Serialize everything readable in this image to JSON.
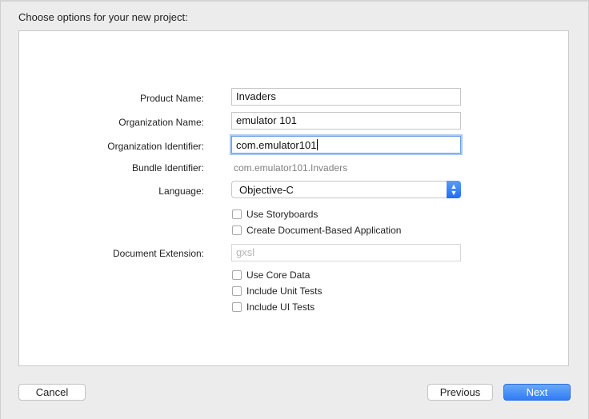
{
  "header": {
    "title": "Choose options for your new project:"
  },
  "form": {
    "product_name": {
      "label": "Product Name:",
      "value": "Invaders"
    },
    "organization_name": {
      "label": "Organization Name:",
      "value": "emulator 101"
    },
    "organization_identifier": {
      "label": "Organization Identifier:",
      "value": "com.emulator101"
    },
    "bundle_identifier": {
      "label": "Bundle Identifier:",
      "value": "com.emulator101.Invaders"
    },
    "language": {
      "label": "Language:",
      "value": "Objective-C"
    },
    "use_storyboards": {
      "label": "Use Storyboards",
      "checked": false
    },
    "document_based": {
      "label": "Create Document-Based Application",
      "checked": false
    },
    "document_extension": {
      "label": "Document Extension:",
      "value": "gxsl"
    },
    "use_core_data": {
      "label": "Use Core Data",
      "checked": false
    },
    "unit_tests": {
      "label": "Include Unit Tests",
      "checked": false
    },
    "ui_tests": {
      "label": "Include UI Tests",
      "checked": false
    }
  },
  "footer": {
    "cancel_label": "Cancel",
    "previous_label": "Previous",
    "next_label": "Next"
  },
  "colors": {
    "accent": "#2f7cf5",
    "focus_ring": "#a9c8f3"
  },
  "icons": {
    "popup_arrows": "chevron-up-down-icon"
  }
}
